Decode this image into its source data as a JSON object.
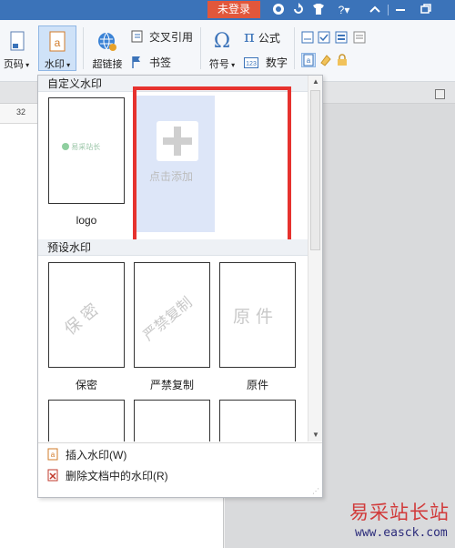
{
  "titlebar": {
    "login_label": "未登录",
    "help_label": "?",
    "icons": [
      "shield-icon",
      "refresh-icon",
      "shirt-icon",
      "help-icon",
      "collapse-icon",
      "minimize-icon",
      "restore-icon"
    ]
  },
  "ribbon": {
    "page_code_label": "页码",
    "watermark_label": "水印",
    "hyperlink_label": "超链接",
    "cross_ref_label": "交叉引用",
    "bookmark_label": "书签",
    "symbol_label": "符号",
    "formula_label": "公式",
    "number_label": "数字",
    "formula_glyph": "π",
    "symbol_glyph": "Ω"
  },
  "ruler": {
    "value": "32"
  },
  "panel": {
    "custom_header": "自定义水印",
    "custom_items": [
      {
        "label": "logo",
        "preview_text": "易采站长"
      }
    ],
    "add_label": "点击添加",
    "preset_header": "预设水印",
    "preset_items": [
      {
        "label": "保密",
        "wm": "保 密"
      },
      {
        "label": "严禁复制",
        "wm": "严禁复制"
      },
      {
        "label": "原件",
        "wm": "原 件"
      }
    ],
    "insert_label": "插入水印(W)",
    "delete_label": "删除文档中的水印(R)"
  },
  "site_watermark": {
    "name": "易采站长站",
    "url": "www.easck.com"
  },
  "colors": {
    "titlebar": "#3b73b9",
    "login": "#e2573b",
    "highlight": "#e6322e",
    "add_bg": "#dde6f8"
  }
}
